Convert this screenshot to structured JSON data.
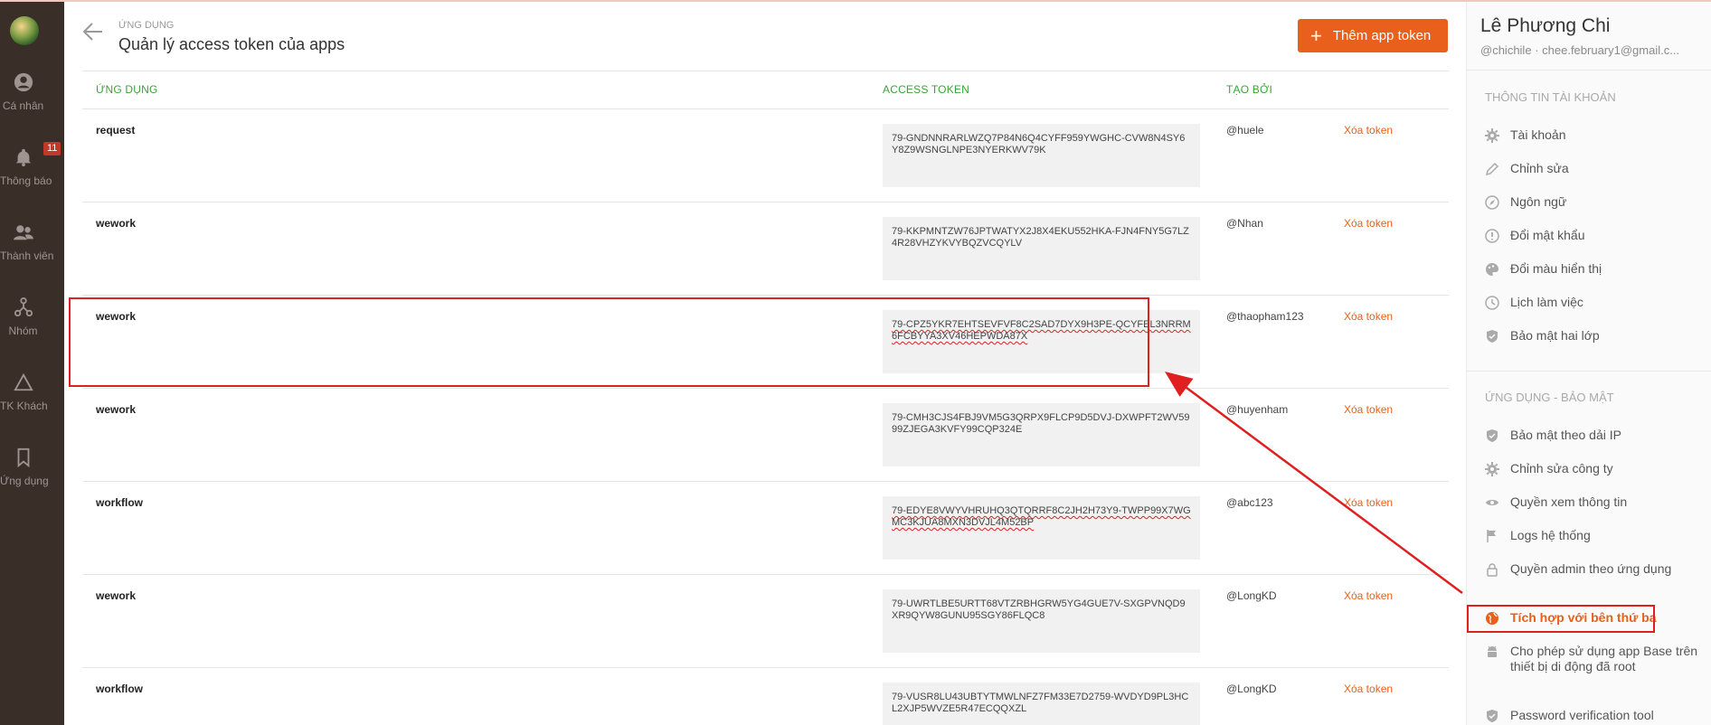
{
  "nav": {
    "items": [
      {
        "label": "Cá nhân",
        "icon": "person-icon"
      },
      {
        "label": "Thông báo",
        "icon": "bell-icon",
        "badge": "11"
      },
      {
        "label": "Thành viên",
        "icon": "members-icon"
      },
      {
        "label": "Nhóm",
        "icon": "group-icon"
      },
      {
        "label": "TK Khách",
        "icon": "triangle-icon"
      },
      {
        "label": "Ứng dụng",
        "icon": "bookmark-icon"
      }
    ]
  },
  "header": {
    "breadcrumb": "ỨNG DỤNG",
    "title": "Quản lý access token của apps",
    "add_button": "Thêm app token"
  },
  "table": {
    "columns": {
      "app": "ỨNG DỤNG",
      "token": "ACCESS TOKEN",
      "created_by": "TẠO BỞI"
    },
    "rows": [
      {
        "app": "request",
        "token": "79-GNDNNRARLWZQ7P84N6Q4CYFF959YWGHC-CVW8N4SY6Y8Z9WSNGLNPE3NYERKWV79K",
        "created_by": "@huele",
        "action": "Xóa token"
      },
      {
        "app": "wework",
        "token": "79-KKPMNTZW76JPTWATYX2J8X4EKU552HKA-FJN4FNY5G7LZ4R28VHZYKVYBQZVCQYLV",
        "created_by": "@Nhan",
        "action": "Xóa token"
      },
      {
        "app": "wework",
        "token": "79-CPZ5YKR7EHTSEVFVF8C2SAD7DYX9H3PE-QCYFEL3NRRM6FCBYYA3XV46HEPWDA87X",
        "created_by": "@thaopham123",
        "action": "Xóa token"
      },
      {
        "app": "wework",
        "token": "79-CMH3CJS4FBJ9VM5G3QRPX9FLCP9D5DVJ-DXWPFT2WV5999ZJEGA3KVFY99CQP324E",
        "created_by": "@huyenham",
        "action": "Xóa token"
      },
      {
        "app": "workflow",
        "token": "79-EDYE8VWYVHRUHQ3QTQRRF8C2JH2H73Y9-TWPP99X7WGMC3KJUA8MXN3DVJL4M52BP",
        "created_by": "@abc123",
        "action": "Xóa token"
      },
      {
        "app": "wework",
        "token": "79-UWRTLBE5URTT68VTZRBHGRW5YG4GUE7V-SXGPVNQD9XR9QYW8GUNU95SGY86FLQC8",
        "created_by": "@LongKD",
        "action": "Xóa token"
      },
      {
        "app": "workflow",
        "token": "79-VUSR8LU43UBTYTMWLNFZ7FM33E7D2759-WVDYD9PL3HCL2XJP5WVZE5R47ECQQXZL",
        "created_by": "@LongKD",
        "action": "Xóa token"
      }
    ]
  },
  "profile": {
    "name": "Lê Phương Chi",
    "handle": "@chichile",
    "email": "chee.february1@gmail.c..."
  },
  "account_section": {
    "title": "THÔNG TIN TÀI KHOẢN",
    "items": [
      {
        "label": "Tài khoản",
        "icon": "gear-icon"
      },
      {
        "label": "Chỉnh sửa",
        "icon": "pencil-icon"
      },
      {
        "label": "Ngôn ngữ",
        "icon": "compass-icon"
      },
      {
        "label": "Đổi mật khẩu",
        "icon": "alert-circle-icon"
      },
      {
        "label": "Đổi màu hiển thị",
        "icon": "palette-icon"
      },
      {
        "label": "Lịch làm việc",
        "icon": "clock-icon"
      },
      {
        "label": "Bảo mật hai lớp",
        "icon": "shield-icon"
      }
    ]
  },
  "security_section": {
    "title": "ỨNG DỤNG - BẢO MẬT",
    "items": [
      {
        "label": "Bảo mật theo dải IP",
        "icon": "shield-icon"
      },
      {
        "label": "Chỉnh sửa công ty",
        "icon": "gear-icon"
      },
      {
        "label": "Quyền xem thông tin",
        "icon": "eye-icon"
      },
      {
        "label": "Logs hệ thống",
        "icon": "flag-icon"
      },
      {
        "label": "Quyền admin theo ứng dụng",
        "icon": "lock-icon"
      },
      {
        "label": "Tích hợp với bên thứ ba",
        "icon": "globe-icon",
        "active": true
      },
      {
        "label": "Cho phép sử dụng app Base trên thiết bị di động đã root",
        "icon": "android-icon"
      },
      {
        "label": "Password verification tool",
        "icon": "shield-icon"
      }
    ]
  },
  "colors": {
    "accent": "#e8601c",
    "header_green": "#3aa33a",
    "sidebar": "#3a2e28",
    "highlight": "#e02020"
  }
}
